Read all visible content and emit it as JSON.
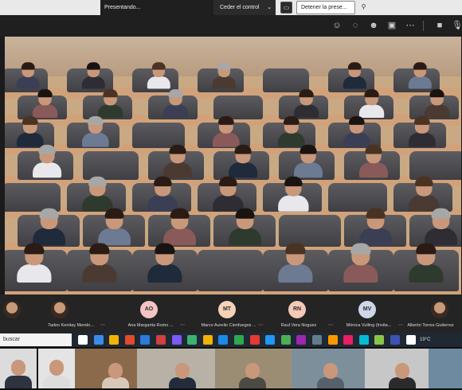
{
  "presenter_bar": {
    "status": "Presentando...",
    "ceder_control": "Ceder el control",
    "detener": "Detener la prese..."
  },
  "toolbar": {
    "icons": [
      "people-icon",
      "chat-icon",
      "reactions-icon",
      "rooms-icon",
      "more-icon",
      "camera-icon",
      "mic-icon"
    ]
  },
  "participants": [
    {
      "initials": "",
      "name": "Tadeo Kenitay Mendo...",
      "color": ""
    },
    {
      "initials": "AO",
      "name": "Ana Margarita Romo ...",
      "color": "#f4c3c3"
    },
    {
      "initials": "MT",
      "name": "Marco Aurelio Cienfuegos ...",
      "color": "#f6d2b8"
    },
    {
      "initials": "RN",
      "name": "Raul Vera Noguez",
      "color": "#f4c9b8"
    },
    {
      "initials": "MV",
      "name": "Mónica Vulling (Invita...",
      "color": "#cfd6ea"
    },
    {
      "initials": "",
      "name": "Alberto Torres Gutierrez",
      "color": ""
    }
  ],
  "taskbar": {
    "search": "buscar",
    "temperature": "19°C"
  }
}
